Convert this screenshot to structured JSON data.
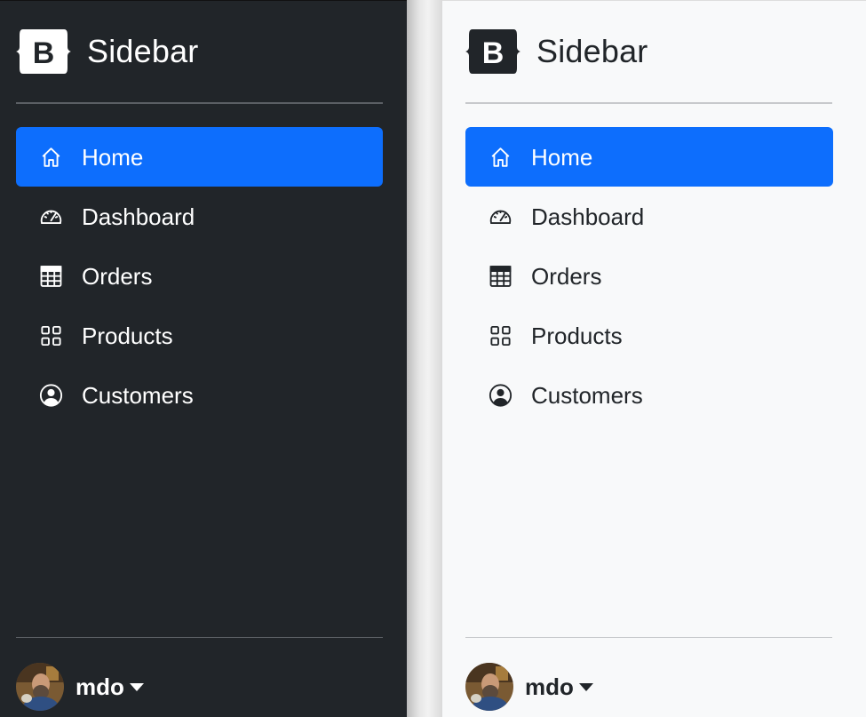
{
  "sidebars": [
    {
      "theme": "dark",
      "brand": {
        "title": "Sidebar",
        "logo_letter": "B"
      },
      "nav_items": [
        {
          "label": "Home",
          "icon": "house-icon",
          "active": true
        },
        {
          "label": "Dashboard",
          "icon": "speedometer-icon",
          "active": false
        },
        {
          "label": "Orders",
          "icon": "table-icon",
          "active": false
        },
        {
          "label": "Products",
          "icon": "grid-icon",
          "active": false
        },
        {
          "label": "Customers",
          "icon": "person-circle-icon",
          "active": false
        }
      ],
      "user": {
        "name": "mdo"
      }
    },
    {
      "theme": "light",
      "brand": {
        "title": "Sidebar",
        "logo_letter": "B"
      },
      "nav_items": [
        {
          "label": "Home",
          "icon": "house-icon",
          "active": true
        },
        {
          "label": "Dashboard",
          "icon": "speedometer-icon",
          "active": false
        },
        {
          "label": "Orders",
          "icon": "table-icon",
          "active": false
        },
        {
          "label": "Products",
          "icon": "grid-icon",
          "active": false
        },
        {
          "label": "Customers",
          "icon": "person-circle-icon",
          "active": false
        }
      ],
      "user": {
        "name": "mdo"
      }
    }
  ],
  "colors": {
    "dark_bg": "#212529",
    "light_bg": "#f8f9fa",
    "accent": "#0d6efd",
    "dark_text": "#ffffff",
    "light_text": "#212529"
  }
}
